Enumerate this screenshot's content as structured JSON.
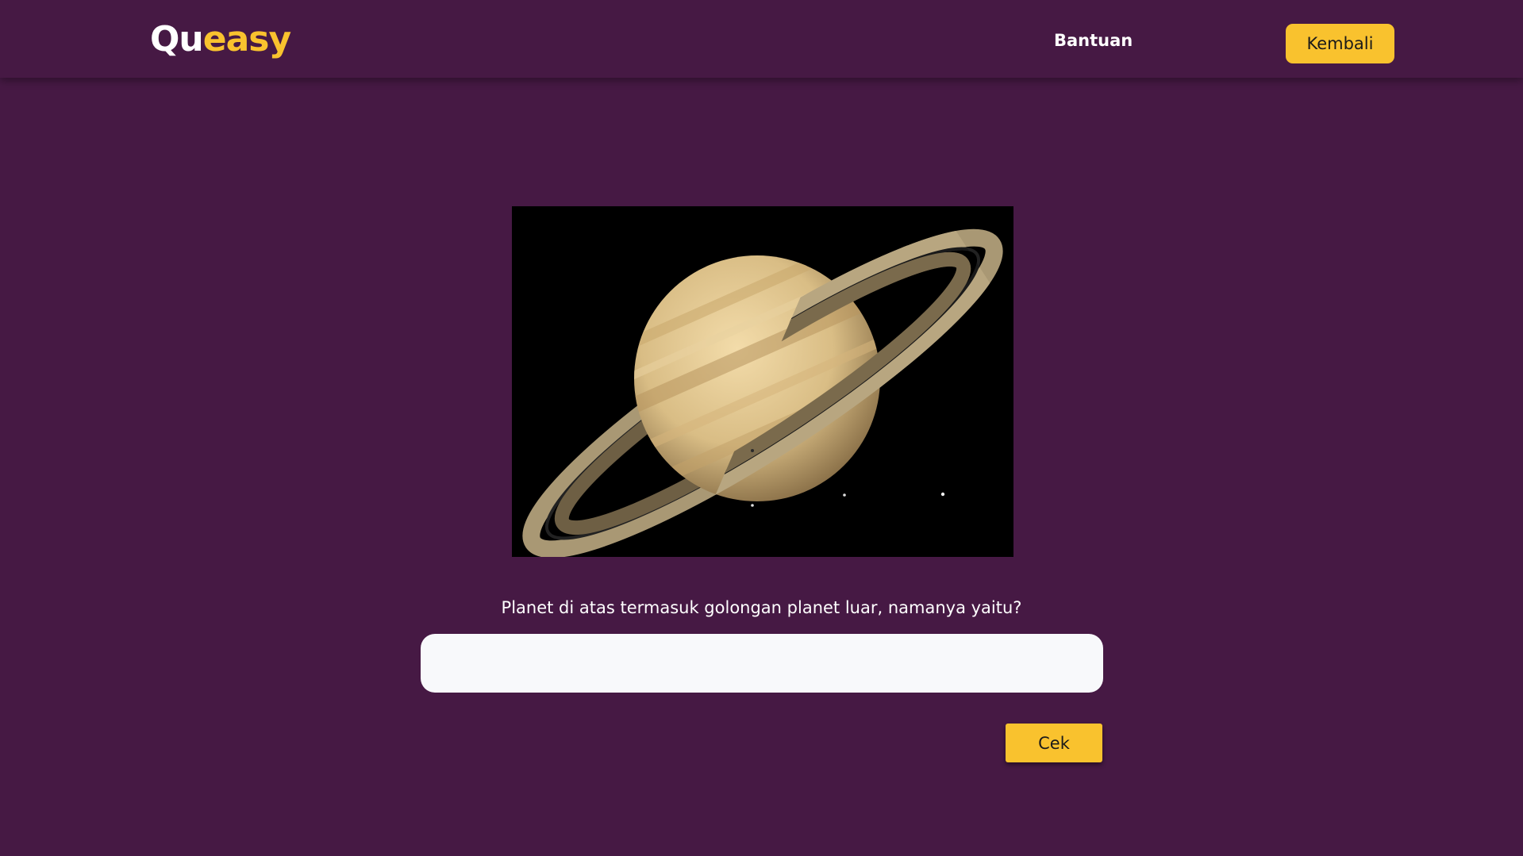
{
  "header": {
    "logo_part1": "Qu",
    "logo_part2": "easy",
    "help_link": "Bantuan",
    "back_button": "Kembali"
  },
  "quiz": {
    "image_subject": "saturn-planet-photo",
    "question": "Planet di atas termasuk golongan planet luar, namanya yaitu?",
    "answer_value": "",
    "answer_placeholder": "",
    "check_button": "Cek"
  },
  "colors": {
    "background": "#461944",
    "accent": "#f9c22e",
    "input_background": "#f8f9fb",
    "text": "#ffffff"
  }
}
